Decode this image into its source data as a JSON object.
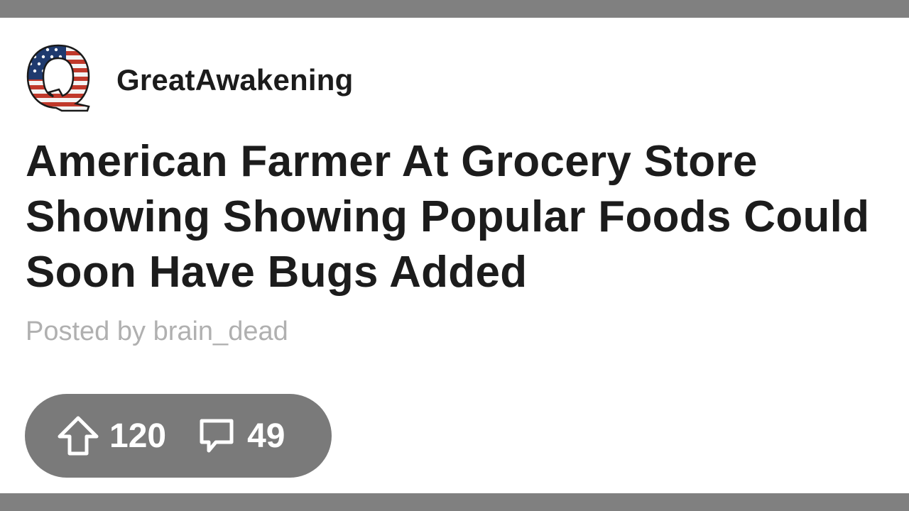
{
  "post": {
    "community": "GreatAwakening",
    "avatar_letter": "Q",
    "title": "American Farmer At Grocery Store Showing Showing Popular Foods Could Soon Have Bugs Added",
    "posted_by_label": "Posted by",
    "author": "brain_dead",
    "stats": {
      "upvotes": "120",
      "comments": "49"
    }
  },
  "colors": {
    "frame_bar": "#808080",
    "stats_pill": "#7a7a7a",
    "title_text": "#1c1c1c",
    "meta_text": "#b0b0b0",
    "avatar_red": "#c0392b",
    "avatar_blue": "#1f3a6e"
  },
  "icons": {
    "avatar": "q-flag-icon",
    "upvote": "upvote-arrow-icon",
    "comments": "comment-bubble-icon"
  }
}
